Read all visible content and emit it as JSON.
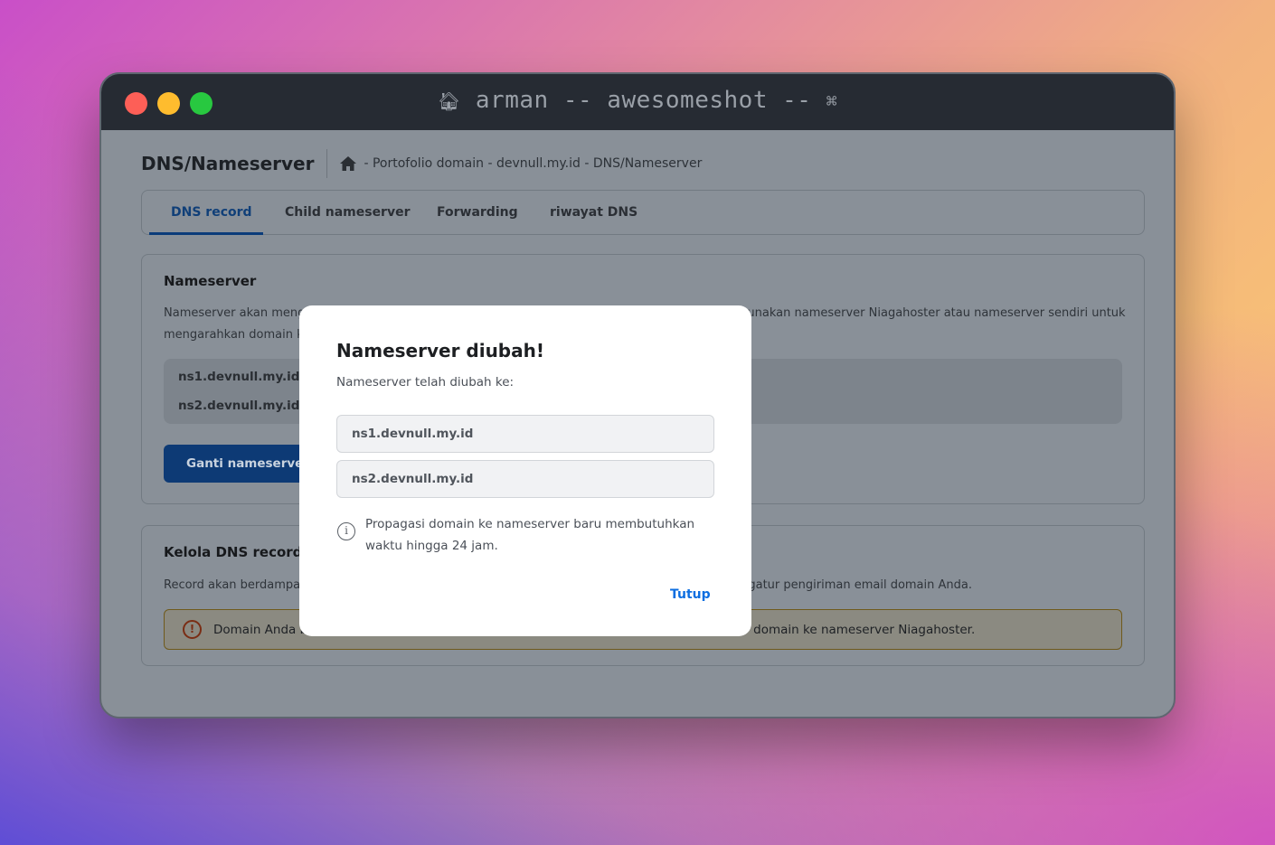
{
  "window": {
    "title": "arman -- awesomeshot --",
    "title_icon_left": "home-icon",
    "title_icon_right": "command-icon"
  },
  "header": {
    "page_title": "DNS/Nameserver",
    "breadcrumb": "- Portofolio domain - devnull.my.id - DNS/Nameserver"
  },
  "tabs": [
    {
      "label": "DNS record",
      "active": true
    },
    {
      "label": "Child nameserver",
      "active": false
    },
    {
      "label": "Forwarding",
      "active": false
    },
    {
      "label": "riwayat DNS",
      "active": false
    }
  ],
  "nameserver_card": {
    "title": "Nameserver",
    "desc_line1_left": "Nameserver akan meng",
    "desc_line1_right": "unakan nameserver Niagahoster atau nameserver sendiri untuk",
    "desc_line2": "mengarahkan domain k",
    "ns1": "ns1.devnull.my.id",
    "ns2": "ns2.devnull.my.id",
    "button": "Ganti nameserver"
  },
  "dns_card": {
    "title": "Kelola DNS record",
    "desc_left": "Record akan berdampa",
    "desc_right": "ngatur pengiriman email domain Anda.",
    "warning_left": "Domain Anda b",
    "warning_right": "domain ke nameserver Niagahoster."
  },
  "modal": {
    "title": "Nameserver diubah!",
    "subtitle": "Nameserver telah diubah ke:",
    "ns1": "ns1.devnull.my.id",
    "ns2": "ns2.devnull.my.id",
    "info": "Propagasi domain ke nameserver baru membutuhkan waktu hingga 24 jam.",
    "close": "Tutup"
  },
  "colors": {
    "accent": "#0d6ee0",
    "primary_button": "#0d3a75",
    "warning_border": "#6f5a1c"
  }
}
